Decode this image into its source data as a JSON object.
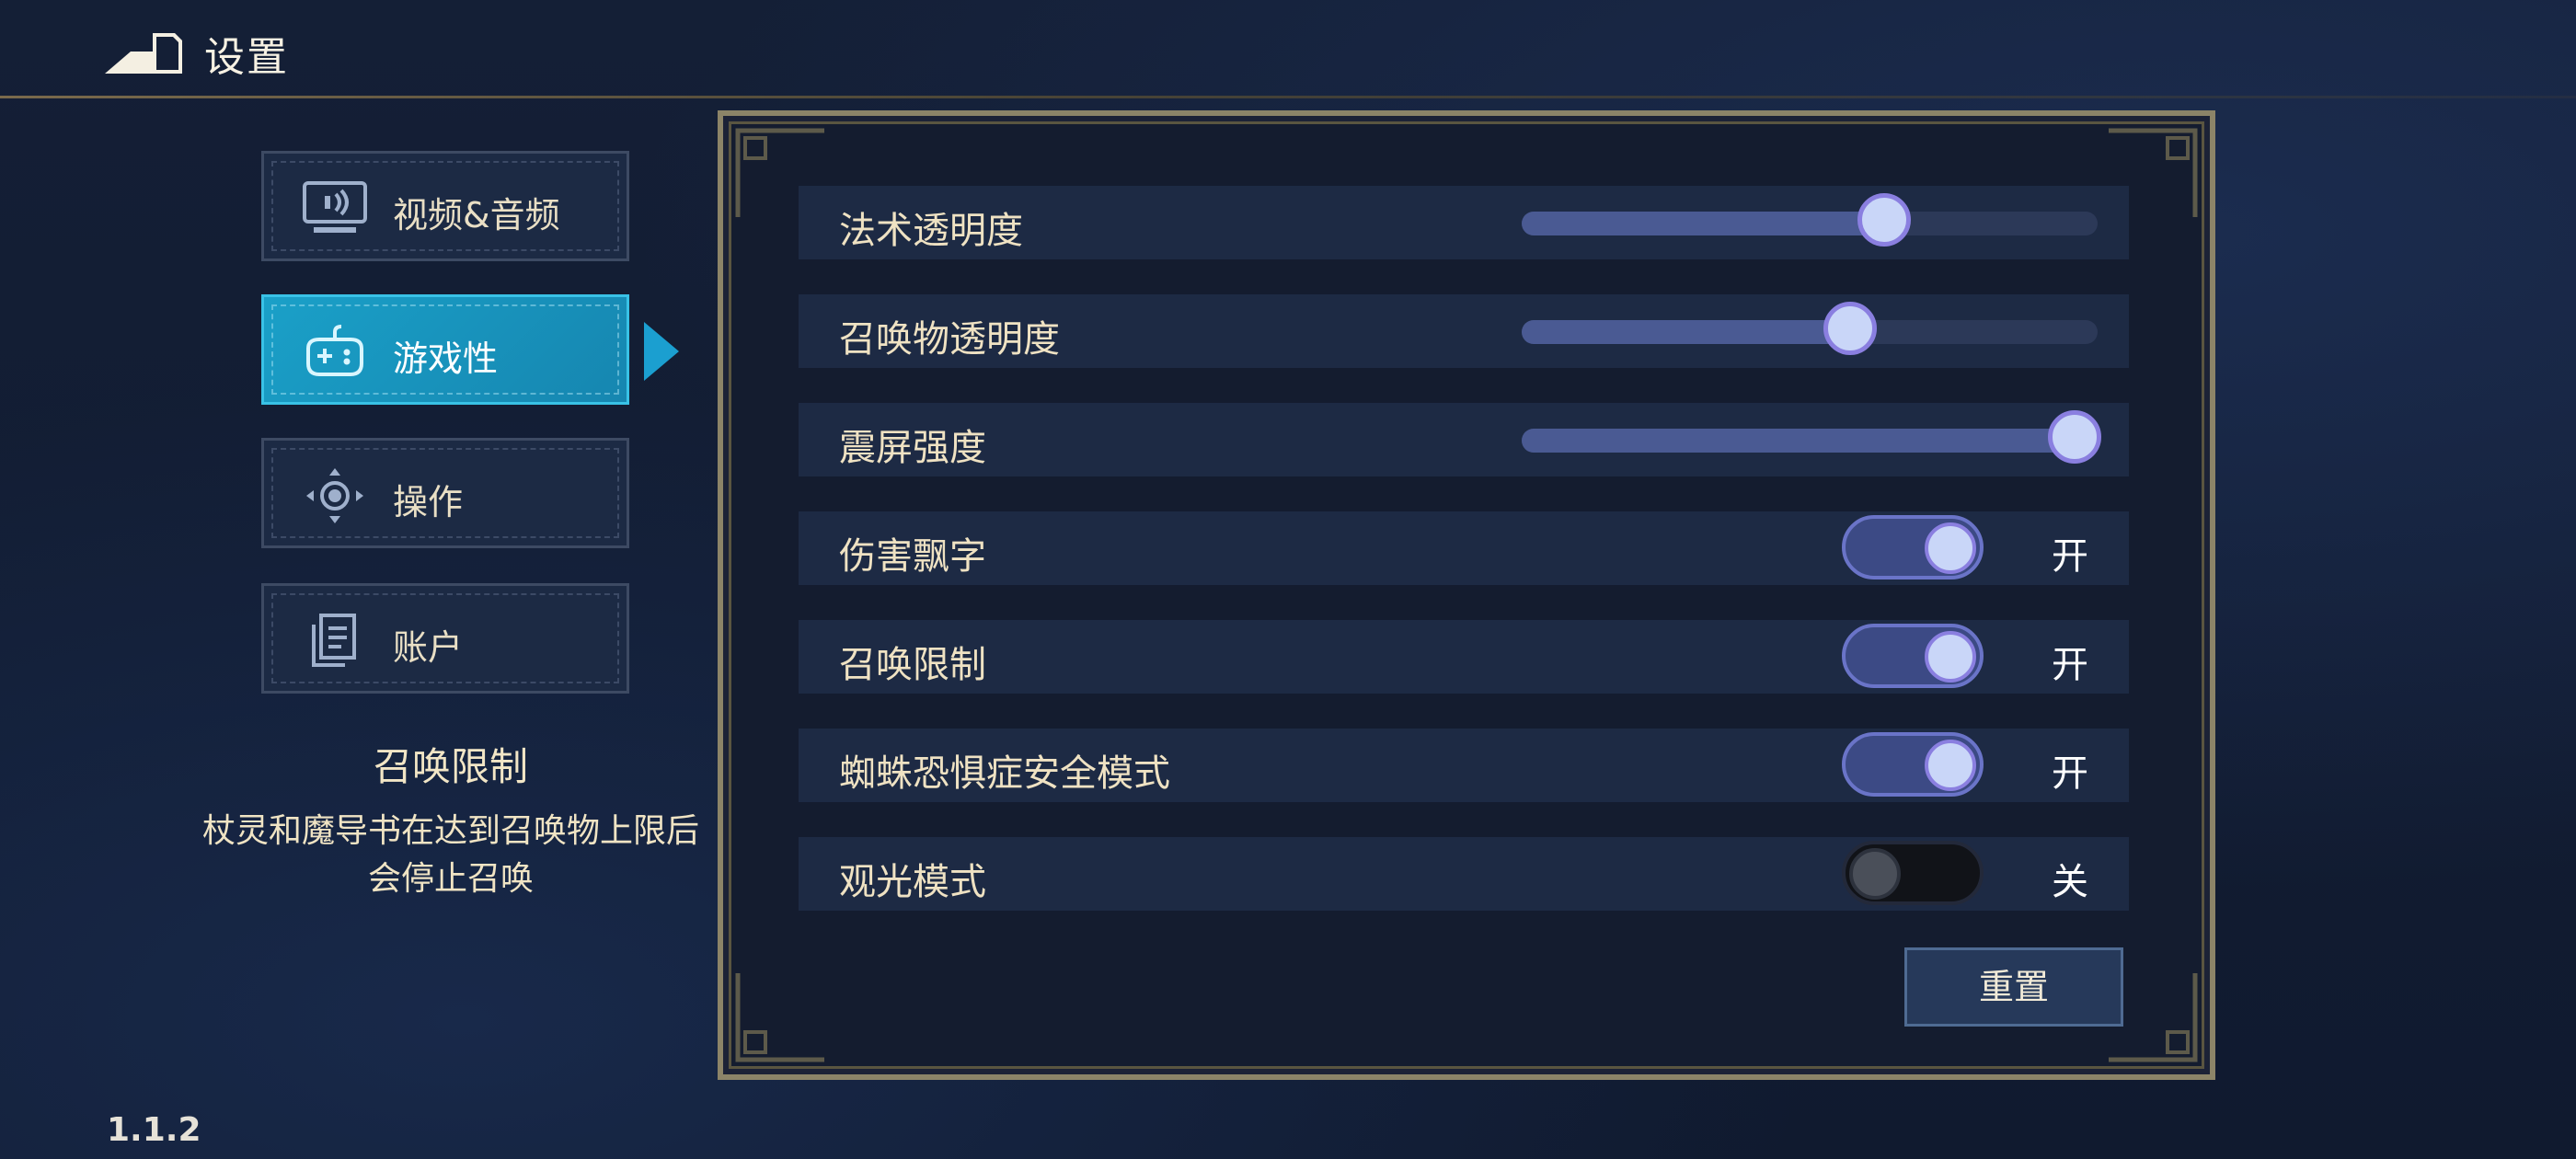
{
  "header": {
    "title": "设置"
  },
  "sidebar": {
    "items": [
      {
        "label": "视频&音频",
        "icon": "monitor-sound-icon",
        "active": false
      },
      {
        "label": "游戏性",
        "icon": "gamepad-icon",
        "active": true
      },
      {
        "label": "操作",
        "icon": "dpad-icon",
        "active": false
      },
      {
        "label": "账户",
        "icon": "documents-icon",
        "active": false
      }
    ]
  },
  "description": {
    "title": "召唤限制",
    "text": "杖灵和魔导书在达到召唤物上限后会停止召唤"
  },
  "version": "1.1.2",
  "settings": {
    "sliders": [
      {
        "label": "法术透明度",
        "value": 0.63
      },
      {
        "label": "召唤物透明度",
        "value": 0.57
      },
      {
        "label": "震屏强度",
        "value": 0.96
      }
    ],
    "toggles": [
      {
        "label": "伤害飘字",
        "on": true,
        "state": "开"
      },
      {
        "label": "召唤限制",
        "on": true,
        "state": "开"
      },
      {
        "label": "蜘蛛恐惧症安全模式",
        "on": true,
        "state": "开"
      },
      {
        "label": "观光模式",
        "on": false,
        "state": "关"
      }
    ]
  },
  "reset_label": "重置",
  "colors": {
    "accent": "#1b9fd0",
    "panel_border": "#8c8468",
    "slider_fill": "#4a5a93",
    "knob": "#c9d6f8"
  }
}
